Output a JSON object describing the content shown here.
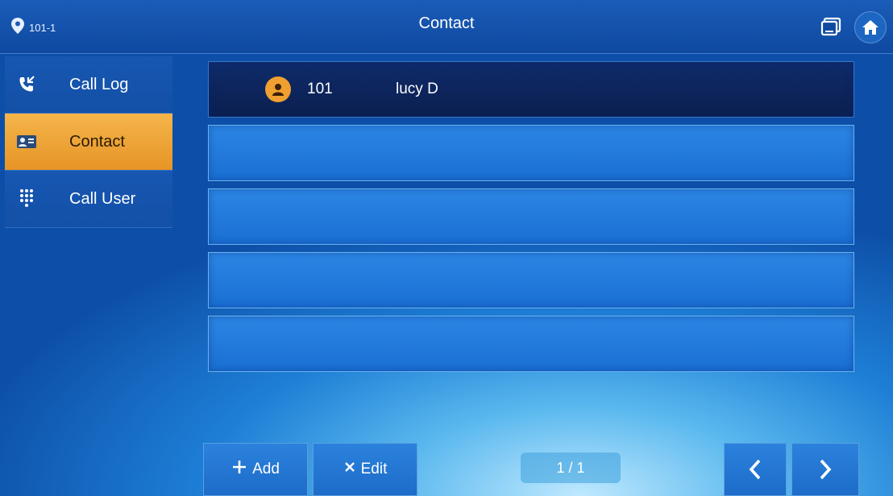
{
  "header": {
    "location": "101-1",
    "title": "Contact"
  },
  "sidebar": {
    "items": [
      {
        "label": "Call Log",
        "icon": "phone-log-icon",
        "active": false
      },
      {
        "label": "Contact",
        "icon": "contact-card-icon",
        "active": true
      },
      {
        "label": "Call User",
        "icon": "dialpad-icon",
        "active": false
      }
    ]
  },
  "contacts": [
    {
      "number": "101",
      "name": "lucy D"
    }
  ],
  "footer": {
    "add_label": "Add",
    "edit_label": "Edit",
    "page_indicator": "1 / 1"
  },
  "colors": {
    "accent": "#e79425",
    "background": "#1e7fd6",
    "header": "#0f49a0"
  }
}
